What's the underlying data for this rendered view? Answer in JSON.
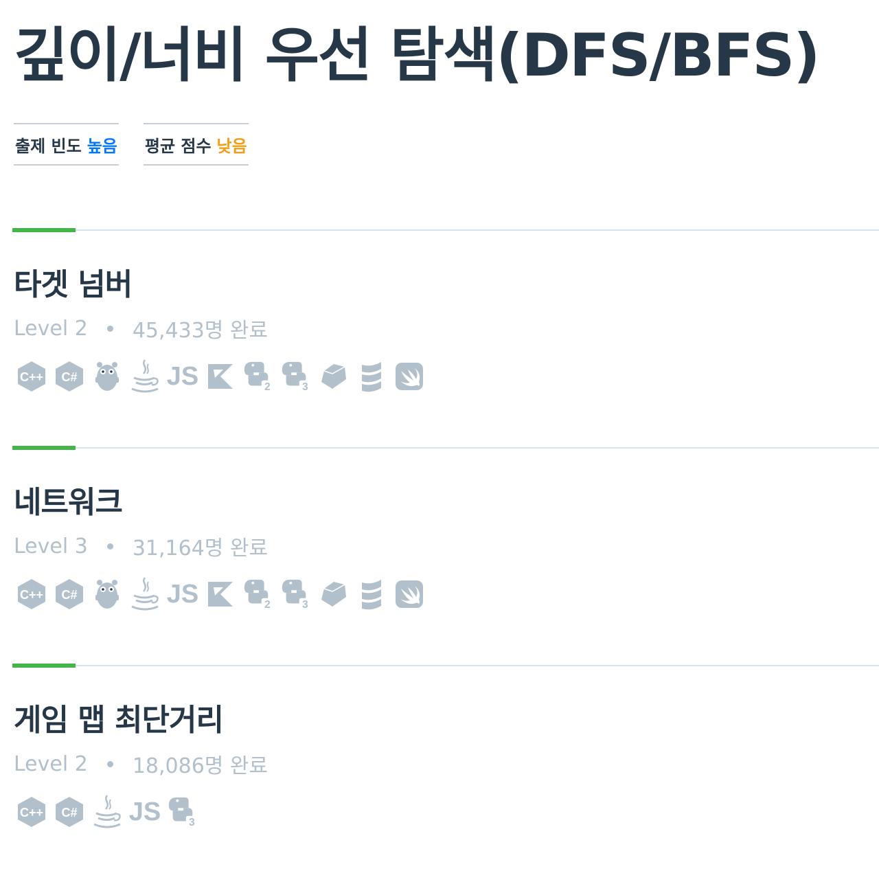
{
  "page_title": "깊이/너비 우선 탐색(DFS/BFS)",
  "badges": [
    {
      "label": "출제 빈도",
      "value": "높음",
      "color": "#0078ff"
    },
    {
      "label": "평균 점수",
      "value": "낮음",
      "color": "#f49d14"
    }
  ],
  "colors": {
    "title": "#263747",
    "muted": "#b2c0cc",
    "accent_bar": "#44b549",
    "rule": "#d7e2eb"
  },
  "problems": [
    {
      "title": "타겟 넘버",
      "level": "Level 2",
      "completed": "45,433명 완료",
      "languages": [
        "cpp-icon",
        "csharp-icon",
        "go-icon",
        "java-icon",
        "javascript-icon",
        "kotlin-icon",
        "python2-icon",
        "python3-icon",
        "ruby-icon",
        "scala-icon",
        "swift-icon"
      ]
    },
    {
      "title": "네트워크",
      "level": "Level 3",
      "completed": "31,164명 완료",
      "languages": [
        "cpp-icon",
        "csharp-icon",
        "go-icon",
        "java-icon",
        "javascript-icon",
        "kotlin-icon",
        "python2-icon",
        "python3-icon",
        "ruby-icon",
        "scala-icon",
        "swift-icon"
      ]
    },
    {
      "title": "게임 맵 최단거리",
      "level": "Level 2",
      "completed": "18,086명 완료",
      "languages": [
        "cpp-icon",
        "csharp-icon",
        "java-icon",
        "javascript-icon",
        "python3-icon"
      ]
    }
  ]
}
